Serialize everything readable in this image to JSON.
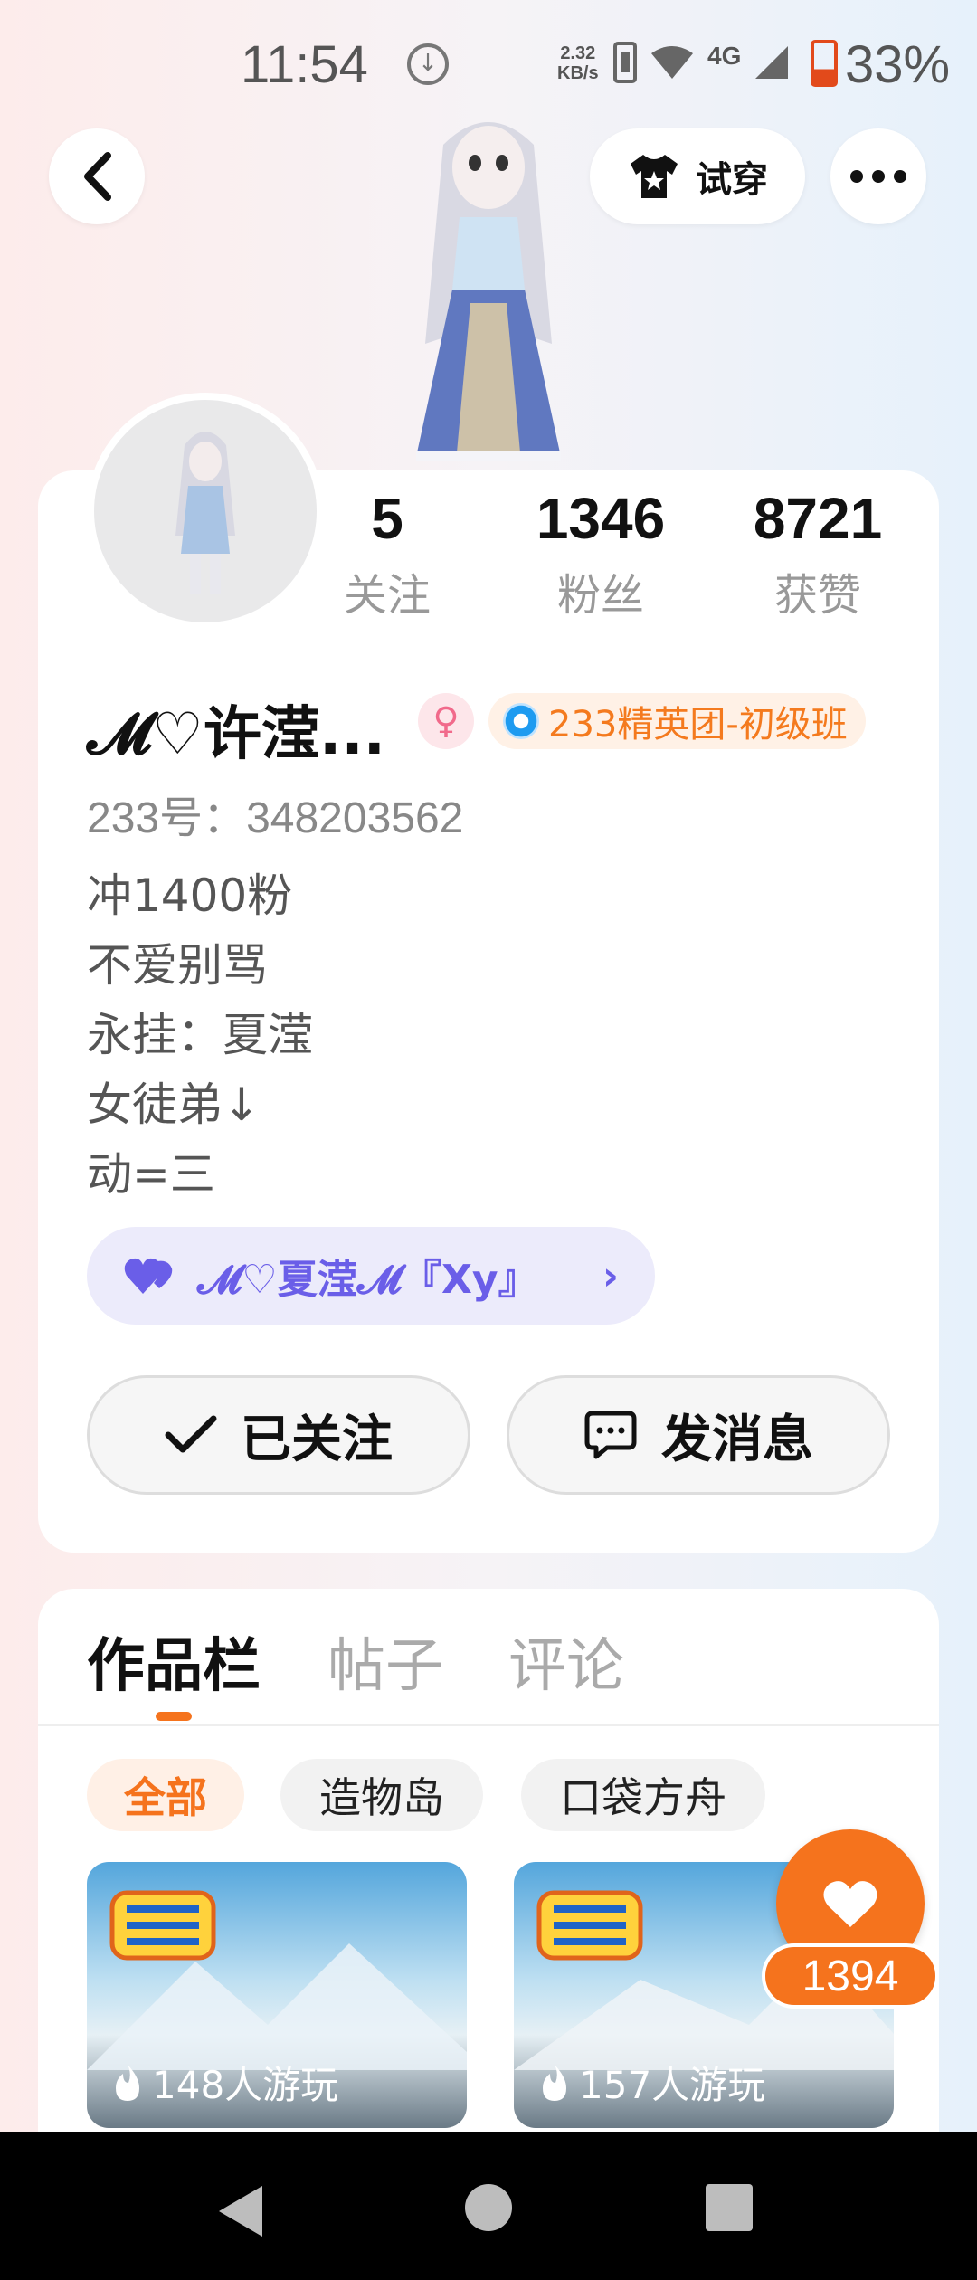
{
  "status_bar": {
    "time": "11:54",
    "net_speed_value": "2.32",
    "net_speed_unit": "KB/s",
    "network": "4G",
    "battery": "33%"
  },
  "top_nav": {
    "try_on_label": "试穿"
  },
  "profile": {
    "stats": [
      {
        "value": "5",
        "label": "关注"
      },
      {
        "value": "1346",
        "label": "粉丝"
      },
      {
        "value": "8721",
        "label": "获赞"
      }
    ],
    "name": "𝓜♡许滢...",
    "rank_badge": "233精英团-初级班",
    "uid": "233号：348203562",
    "bio": [
      "冲1400粉",
      "不爱别骂",
      "永挂：夏滢",
      "女徒弟↓",
      "动=三"
    ],
    "link_label": "𝓜♡夏滢𝓜『Xy』",
    "follow_label": "已关注",
    "message_label": "发消息"
  },
  "works": {
    "tabs": [
      "作品栏",
      "帖子",
      "评论"
    ],
    "chips": [
      "全部",
      "造物岛",
      "口袋方舟"
    ],
    "items": [
      {
        "plays": "148人游玩"
      },
      {
        "plays": "157人游玩"
      }
    ],
    "like_count": "1394"
  },
  "colors": {
    "accent": "#f5731d",
    "link": "#6a5ee8"
  }
}
